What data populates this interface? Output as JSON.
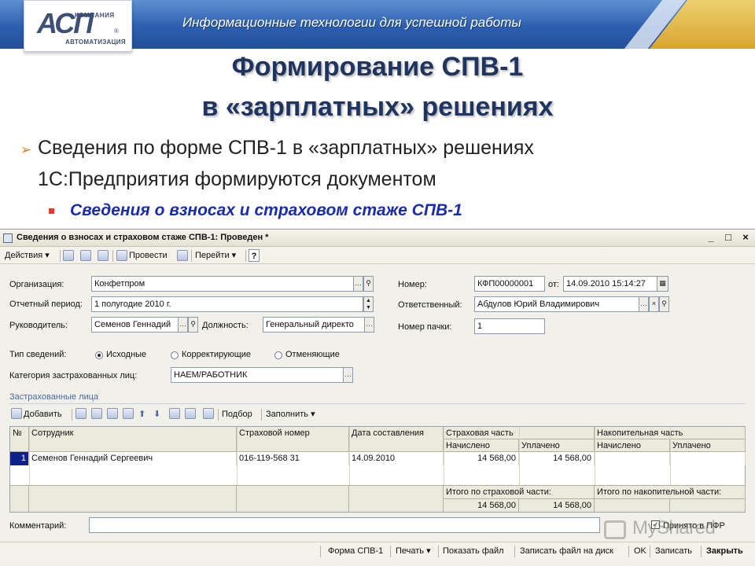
{
  "slide": {
    "banner_text": "Информационные технологии для успешной работы",
    "logo": {
      "company": "КОМПАНИЯ",
      "mark": "АСП",
      "sub": "АВТОМАТИЗАЦИЯ",
      "reg": "®"
    },
    "title_line1": "Формирование СПВ-1",
    "title_line2": "в «зарплатных» решениях",
    "body_line1": "Сведения по форме СПВ-1 в «зарплатных» решениях",
    "body_line2": "1С:Предприятия формируются документом",
    "sub_bullet": "Сведения о взносах и страховом стаже СПВ-1",
    "arrow_glyph": "➢",
    "accent_color": "#1a2ca8"
  },
  "window": {
    "title": "Сведения о взносах и страховом стаже СПВ-1: Проведен *",
    "controls": {
      "min": "_",
      "max": "□",
      "close": "×"
    },
    "toolbar": {
      "actions": "Действия",
      "post": "Провести",
      "goto": "Перейти",
      "help": "?"
    },
    "form": {
      "org_label": "Организация:",
      "org_value": "Конфетпром",
      "period_label": "Отчетный период:",
      "period_value": "1 полугодие 2010 г.",
      "head_label": "Руководитель:",
      "head_value": "Семенов Геннадий",
      "position_label": "Должность:",
      "position_value": "Генеральный директо",
      "number_label": "Номер:",
      "number_value": "КФП00000001",
      "from_label": "от:",
      "date_value": "14.09.2010 15:14:27",
      "resp_label": "Ответственный:",
      "resp_value": "Абдулов Юрий Владимирович",
      "pack_label": "Номер пачки:",
      "pack_value": "1",
      "type_label": "Тип сведений:",
      "type_options": [
        "Исходные",
        "Корректирующие",
        "Отменяющие"
      ],
      "category_label": "Категория застрахованных лиц:",
      "category_value": "НАЕМ/РАБОТНИК"
    },
    "insured": {
      "section_title": "Застрахованные лица",
      "add": "Добавить",
      "select": "Подбор",
      "fill": "Заполнить",
      "headers": {
        "num": "№",
        "employee": "Сотрудник",
        "ins_number": "Страховой номер",
        "date": "Дата составления",
        "ins_part": "Страховая часть",
        "acc_part": "Накопительная часть",
        "accrued": "Начислено",
        "paid": "Уплачено"
      },
      "rows": [
        {
          "num": "1",
          "employee": "Семенов Геннадий Сергеевич",
          "ins_number": "016-119-568 31",
          "date": "14.09.2010",
          "ins_accrued": "14 568,00",
          "ins_paid": "14 568,00",
          "acc_accrued": "",
          "acc_paid": ""
        }
      ],
      "total_ins_label": "Итого по страховой части:",
      "total_acc_label": "Итого по накопительной части:",
      "total_ins_accrued": "14 568,00",
      "total_ins_paid": "14 568,00"
    },
    "comment_label": "Комментарий:",
    "accepted_label": "Принято в ПФР",
    "bottom": {
      "form": "Форма СПВ-1",
      "print": "Печать",
      "show_file": "Показать файл",
      "save_disk": "Записать файл на диск",
      "ok": "OK",
      "save": "Записать",
      "close": "Закрыть"
    }
  },
  "watermark": "MyShared"
}
